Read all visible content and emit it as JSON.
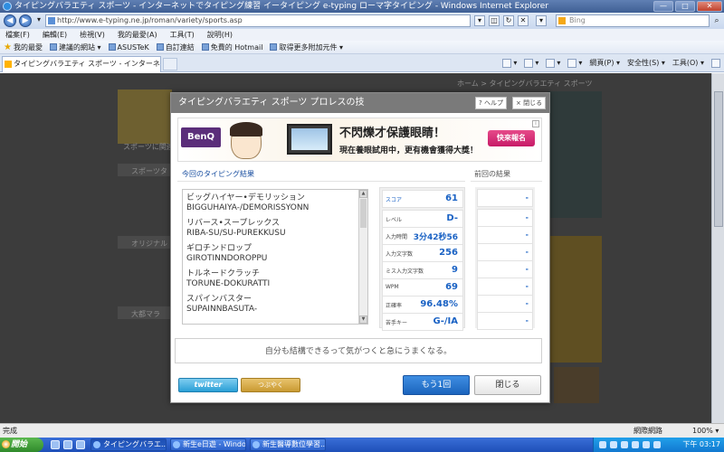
{
  "window": {
    "title": "タイピングバラエティ スポーツ - インターネットでタイピング練習 イータイピング  e-typing ローマ字タイピング - Windows Internet Explorer"
  },
  "address": {
    "url": "http://www.e-typing.ne.jp/roman/variety/sports.asp",
    "search_placeholder": "Bing"
  },
  "menu": [
    "檔案(F)",
    "編輯(E)",
    "檢視(V)",
    "我的最愛(A)",
    "工具(T)",
    "說明(H)"
  ],
  "favorites": {
    "label": "我的最愛",
    "items": [
      "建議的網站 ▾",
      "ASUSTeK",
      "自訂連結",
      "免費的 Hotmail",
      "取得更多附加元件 ▾"
    ]
  },
  "tab": {
    "label": "タイピングバラエティ スポーツ - インターネ..."
  },
  "command_bar": {
    "items": [
      "網頁(P) ▾",
      "安全性(S) ▾",
      "工具(O) ▾"
    ]
  },
  "background": {
    "breadcrumb": "ホーム > タイピングバラエティ スポーツ",
    "left_texts": [
      "スポーツに関連",
      "スポーツタ",
      "オリジナル",
      "大都マラ"
    ]
  },
  "dialog": {
    "title": "タイピングバラエティ スポーツ プロレスの技",
    "help_label": "? ヘルプ",
    "close_top_label": "× 閉じる",
    "ad": {
      "brand": "BenQ",
      "headline": "不閃爍才保護眼睛！",
      "sub": "現在養眼試用中，更有機會獲得大獎！",
      "cta": "快來報名"
    },
    "results_header": "今回のタイピング結果",
    "prev_header": "前回の結果",
    "words": [
      {
        "jp": "ビッグハイヤー•デモリッション",
        "roma": "BIGGUHAIYA-/DEMORISSYONN"
      },
      {
        "jp": "リバース•スープレックス",
        "roma": "RIBA-SU/SU-PUREKKUSU"
      },
      {
        "jp": "ギロチンドロップ",
        "roma": "GIROTINNDOROPPU"
      },
      {
        "jp": "トルネードクラッチ",
        "roma": "TORUNE-DOKURATTI"
      },
      {
        "jp": "スパインバスター",
        "roma": "SUPAINNBASUTA-"
      }
    ],
    "stats": [
      {
        "label": "スコア",
        "value": "61"
      },
      {
        "label": "レベル",
        "value": "D-"
      },
      {
        "label": "入力時間",
        "value": "3分42秒56"
      },
      {
        "label": "入力文字数",
        "value": "256"
      },
      {
        "label": "ミス入力文字数",
        "value": "9"
      },
      {
        "label": "WPM",
        "value": "69"
      },
      {
        "label": "正確率",
        "value": "96.48%"
      },
      {
        "label": "苦手キー",
        "value": "G-/IA"
      }
    ],
    "prev_values": [
      "-",
      "-",
      "-",
      "-",
      "-",
      "-",
      "-",
      "-"
    ],
    "comment": "自分も結構できるって気がつくと急にうまくなる。",
    "twitter_label": "twitter",
    "tsubuyaku_label": "つぶやく",
    "retry_label": "もう1回",
    "close_label": "閉じる"
  },
  "status": {
    "text": "完成",
    "zone": "網際網路",
    "zoom": "100% ▾"
  },
  "taskbar": {
    "start": "開始",
    "tasks": [
      "タイピングバラエ...",
      "新生e日遊 - Windows...",
      "新生醫導數位學習..."
    ],
    "clock": "下午 03:17"
  }
}
